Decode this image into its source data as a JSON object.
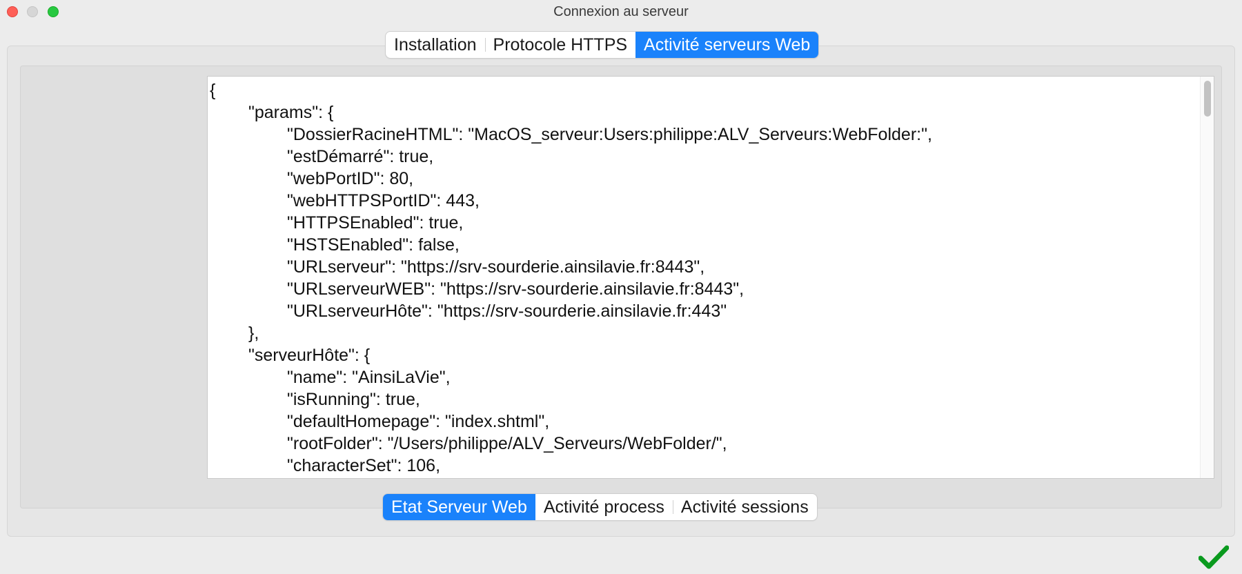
{
  "window": {
    "title": "Connexion au serveur"
  },
  "top_tabs": [
    {
      "label": "Installation",
      "active": false
    },
    {
      "label": "Protocole HTTPS",
      "active": false
    },
    {
      "label": "Activité serveurs Web",
      "active": true
    }
  ],
  "bottom_tabs": [
    {
      "label": "Etat Serveur Web",
      "active": true
    },
    {
      "label": "Activité process",
      "active": false
    },
    {
      "label": "Activité sessions",
      "active": false
    }
  ],
  "json_text": {
    "lines": [
      "{",
      "\"params\": {",
      "\"DossierRacineHTML\": \"MacOS_serveur:Users:philippe:ALV_Serveurs:WebFolder:\",",
      "\"estDémarré\": true,",
      "\"webPortID\": 80,",
      "\"webHTTPSPortID\": 443,",
      "\"HTTPSEnabled\": true,",
      "\"HSTSEnabled\": false,",
      "\"URLserveur\": \"https://srv-sourderie.ainsilavie.fr:8443\",",
      "\"URLserveurWEB\": \"https://srv-sourderie.ainsilavie.fr:8443\",",
      "\"URLserveurHôte\": \"https://srv-sourderie.ainsilavie.fr:443\"",
      "},",
      "\"serveurHôte\": {",
      "\"name\": \"AinsiLaVie\",",
      "\"isRunning\": true,",
      "\"defaultHomepage\": \"index.shtml\",",
      "\"rootFolder\": \"/Users/philippe/ALV_Serveurs/WebFolder/\",",
      "\"characterSet\": 106,"
    ]
  },
  "colors": {
    "accent": "#1a82fb",
    "close": "#fe5f57",
    "maximize": "#27c840",
    "ok_check": "#0a9a1e"
  },
  "icons": {
    "ok": "checkmark-icon"
  }
}
